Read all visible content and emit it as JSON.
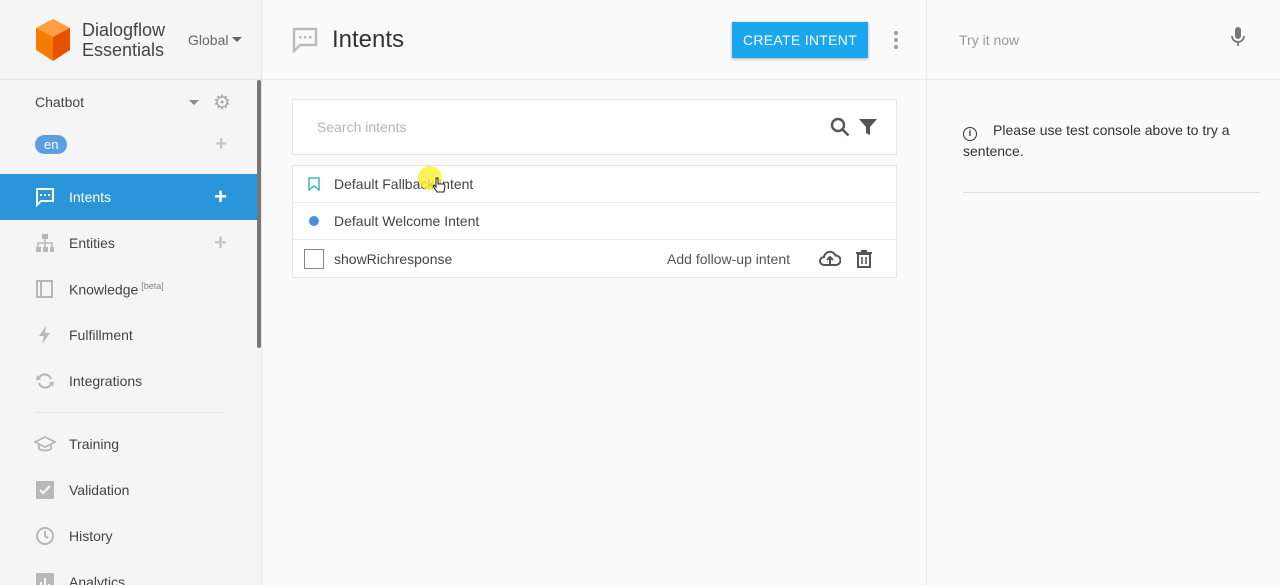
{
  "brand": {
    "line1": "Dialogflow",
    "line2": "Essentials",
    "region": "Global"
  },
  "agent": {
    "name": "Chatbot",
    "language": "en"
  },
  "nav": {
    "items": [
      {
        "label": "Intents",
        "icon": "chat-bubble-icon",
        "active": true
      },
      {
        "label": "Entities",
        "icon": "hierarchy-icon"
      },
      {
        "label": "Knowledge",
        "badge": "[beta]",
        "icon": "book-icon"
      },
      {
        "label": "Fulfillment",
        "icon": "bolt-icon"
      },
      {
        "label": "Integrations",
        "icon": "sync-icon"
      },
      {
        "label": "Training",
        "icon": "graduation-cap-icon"
      },
      {
        "label": "Validation",
        "icon": "check-box-icon"
      },
      {
        "label": "History",
        "icon": "clock-icon"
      },
      {
        "label": "Analytics",
        "icon": "bar-chart-icon"
      }
    ]
  },
  "header": {
    "title": "Intents",
    "create_label": "CREATE INTENT"
  },
  "search": {
    "placeholder": "Search intents"
  },
  "intents": [
    {
      "name": "Default Fallback Intent",
      "icon": "bookmark-icon"
    },
    {
      "name": "Default Welcome Intent",
      "icon": "dot-icon"
    },
    {
      "name": "showRichresponse",
      "icon": "checkbox",
      "followup": "Add follow-up intent"
    }
  ],
  "test_console": {
    "placeholder": "Try it now",
    "info": "Please use test console above to try a sentence."
  },
  "colors": {
    "accent": "#2b95d9",
    "button": "#1ba7f0",
    "logo": "#ef6c00"
  }
}
